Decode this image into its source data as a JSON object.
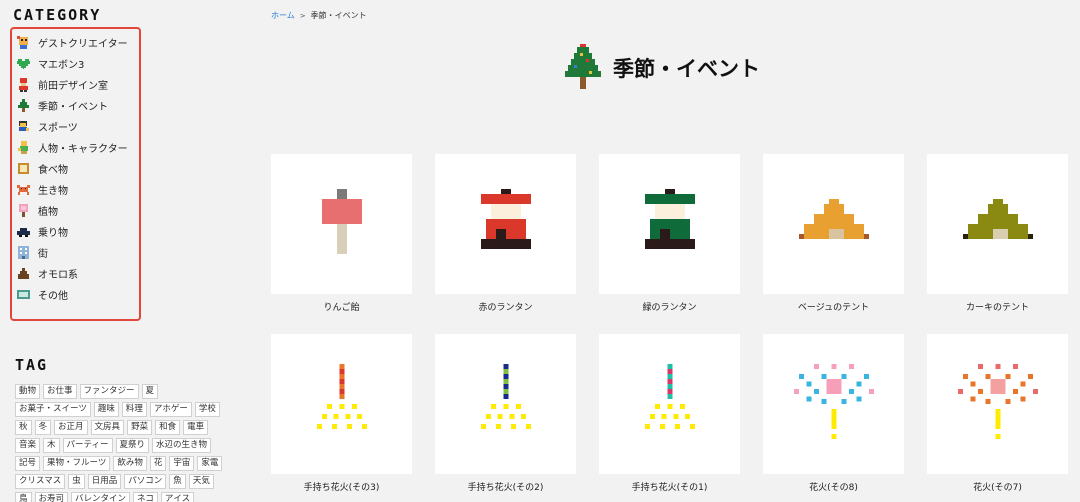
{
  "sidebar": {
    "category_heading": "CATEGORY",
    "categories": [
      {
        "label": "ゲストクリエイター",
        "icon": "guest-creator-icon"
      },
      {
        "label": "マエボン3",
        "icon": "heart-icon"
      },
      {
        "label": "前田デザイン室",
        "icon": "maeda-design-icon"
      },
      {
        "label": "季節・イベント",
        "icon": "tree-icon"
      },
      {
        "label": "スポーツ",
        "icon": "sports-icon"
      },
      {
        "label": "人物・キャラクター",
        "icon": "character-icon"
      },
      {
        "label": "食べ物",
        "icon": "food-icon"
      },
      {
        "label": "生き物",
        "icon": "creature-icon"
      },
      {
        "label": "植物",
        "icon": "plant-icon"
      },
      {
        "label": "乗り物",
        "icon": "vehicle-icon"
      },
      {
        "label": "街",
        "icon": "building-icon"
      },
      {
        "label": "オモロ系",
        "icon": "poop-icon"
      },
      {
        "label": "その他",
        "icon": "other-icon"
      }
    ],
    "tag_heading": "TAG",
    "tags": [
      "動物",
      "お仕事",
      "ファンタジー",
      "夏",
      "お菓子・スイーツ",
      "趣味",
      "料理",
      "アホゲー",
      "学校",
      "秋",
      "冬",
      "お正月",
      "文房具",
      "野菜",
      "和食",
      "電車",
      "音楽",
      "木",
      "パーティー",
      "夏祭り",
      "水辺の生き物",
      "記号",
      "果物・フルーツ",
      "飲み物",
      "花",
      "宇宙",
      "家電",
      "クリスマス",
      "虫",
      "日用品",
      "パソコン",
      "魚",
      "天気",
      "鳥",
      "お寿司",
      "バレンタイン",
      "ネコ",
      "アイス"
    ]
  },
  "breadcrumb": {
    "home": "ホーム",
    "separator": ">",
    "current": "季節・イベント"
  },
  "main": {
    "title": "季節・イベント",
    "items": [
      {
        "label": "りんご飴",
        "icon": "candy-apple-icon"
      },
      {
        "label": "赤のランタン",
        "icon": "red-lantern-icon"
      },
      {
        "label": "緑のランタン",
        "icon": "green-lantern-icon"
      },
      {
        "label": "ベージュのテント",
        "icon": "beige-tent-icon"
      },
      {
        "label": "カーキのテント",
        "icon": "khaki-tent-icon"
      },
      {
        "label": "手持ち花火(その3)",
        "icon": "sparkler-orange-icon"
      },
      {
        "label": "手持ち花火(その2)",
        "icon": "sparkler-blue-icon"
      },
      {
        "label": "手持ち花火(その1)",
        "icon": "sparkler-pink-icon"
      },
      {
        "label": "花火(その8)",
        "icon": "firework-pastel-icon"
      },
      {
        "label": "花火(その7)",
        "icon": "firework-warm-icon"
      }
    ]
  },
  "colors": {
    "category_border": "#e0473a",
    "link": "#2a7fd4",
    "background": "#f2f2f2"
  }
}
